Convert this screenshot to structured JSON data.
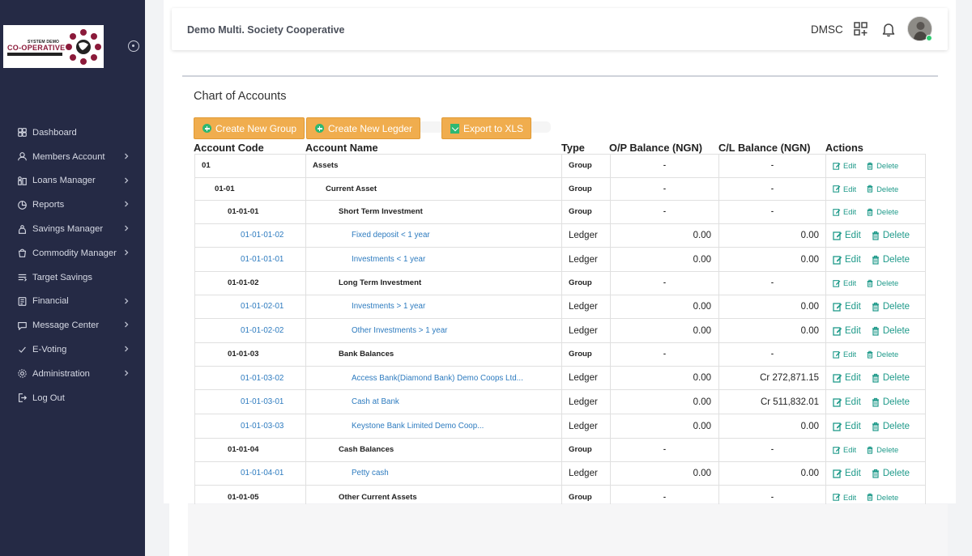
{
  "sidebar": {
    "logo": {
      "small_text": "SYSTEM DEMO",
      "main_text": "CO-OPERATIVE"
    },
    "items": [
      {
        "label": "Dashboard",
        "icon": "dashboard-icon",
        "has_submenu": false
      },
      {
        "label": "Members Account",
        "icon": "user-icon",
        "has_submenu": true
      },
      {
        "label": "Loans Manager",
        "icon": "loan-icon",
        "has_submenu": true
      },
      {
        "label": "Reports",
        "icon": "chart-icon",
        "has_submenu": true
      },
      {
        "label": "Savings Manager",
        "icon": "savings-icon",
        "has_submenu": true
      },
      {
        "label": "Commodity Manager",
        "icon": "bag-icon",
        "has_submenu": true
      },
      {
        "label": "Target Savings",
        "icon": "target-icon",
        "has_submenu": false
      },
      {
        "label": "Financial",
        "icon": "financial-icon",
        "has_submenu": true
      },
      {
        "label": "Message Center",
        "icon": "message-icon",
        "has_submenu": true
      },
      {
        "label": "E-Voting",
        "icon": "vote-icon",
        "has_submenu": true
      },
      {
        "label": "Administration",
        "icon": "settings-icon",
        "has_submenu": true
      },
      {
        "label": "Log Out",
        "icon": "logout-icon",
        "has_submenu": false
      }
    ]
  },
  "header": {
    "org_name": "Demo Multi. Society Cooperative",
    "code": "DMSC"
  },
  "page": {
    "title": "Chart of Accounts",
    "buttons": {
      "create_group": "Create New Group",
      "create_ledger": "Create New Legder",
      "export": "Export to XLS"
    }
  },
  "table": {
    "headers": {
      "code": "Account Code",
      "name": "Account Name",
      "type": "Type",
      "op": "O/P Balance (NGN)",
      "cl": "C/L Balance (NGN)",
      "actions": "Actions"
    },
    "edit_label": "Edit",
    "delete_label": "Delete",
    "rows": [
      {
        "kind": "group",
        "level": 0,
        "code": "01",
        "name": "Assets",
        "type": "Group",
        "op": "-",
        "cl": "-"
      },
      {
        "kind": "group",
        "level": 1,
        "code": "01-01",
        "name": "Current Asset",
        "type": "Group",
        "op": "-",
        "cl": "-"
      },
      {
        "kind": "group",
        "level": 2,
        "code": "01-01-01",
        "name": "Short Term Investment",
        "type": "Group",
        "op": "-",
        "cl": "-"
      },
      {
        "kind": "ledger",
        "level": 3,
        "code": "01-01-01-02",
        "name": "Fixed deposit < 1 year",
        "type": "Ledger",
        "op": "0.00",
        "cl": "0.00"
      },
      {
        "kind": "ledger",
        "level": 3,
        "code": "01-01-01-01",
        "name": "Investments < 1 year",
        "type": "Ledger",
        "op": "0.00",
        "cl": "0.00"
      },
      {
        "kind": "group",
        "level": 2,
        "code": "01-01-02",
        "name": "Long Term Investment",
        "type": "Group",
        "op": "-",
        "cl": "-"
      },
      {
        "kind": "ledger",
        "level": 3,
        "code": "01-01-02-01",
        "name": "Investments > 1 year",
        "type": "Ledger",
        "op": "0.00",
        "cl": "0.00"
      },
      {
        "kind": "ledger",
        "level": 3,
        "code": "01-01-02-02",
        "name": "Other Investments > 1 year",
        "type": "Ledger",
        "op": "0.00",
        "cl": "0.00"
      },
      {
        "kind": "group",
        "level": 2,
        "code": "01-01-03",
        "name": "Bank Balances",
        "type": "Group",
        "op": "-",
        "cl": "-"
      },
      {
        "kind": "ledger",
        "level": 3,
        "code": "01-01-03-02",
        "name": "Access Bank(Diamond Bank) Demo Coops Ltd...",
        "type": "Ledger",
        "op": "0.00",
        "cl": "Cr 272,871.15"
      },
      {
        "kind": "ledger",
        "level": 3,
        "code": "01-01-03-01",
        "name": "Cash at Bank",
        "type": "Ledger",
        "op": "0.00",
        "cl": "Cr 511,832.01"
      },
      {
        "kind": "ledger",
        "level": 3,
        "code": "01-01-03-03",
        "name": "Keystone Bank Limited Demo Coop...",
        "type": "Ledger",
        "op": "0.00",
        "cl": "0.00"
      },
      {
        "kind": "group",
        "level": 2,
        "code": "01-01-04",
        "name": "Cash Balances",
        "type": "Group",
        "op": "-",
        "cl": "-"
      },
      {
        "kind": "ledger",
        "level": 3,
        "code": "01-01-04-01",
        "name": "Petty cash",
        "type": "Ledger",
        "op": "0.00",
        "cl": "0.00"
      },
      {
        "kind": "group",
        "level": 2,
        "code": "01-01-05",
        "name": "Other Current Assets",
        "type": "Group",
        "op": "-",
        "cl": "-"
      }
    ]
  },
  "colors": {
    "sidebar_bg": "#252a45",
    "button_bg": "#f0ad4e",
    "link": "#2d7bbf",
    "action": "#1f9a8a"
  }
}
